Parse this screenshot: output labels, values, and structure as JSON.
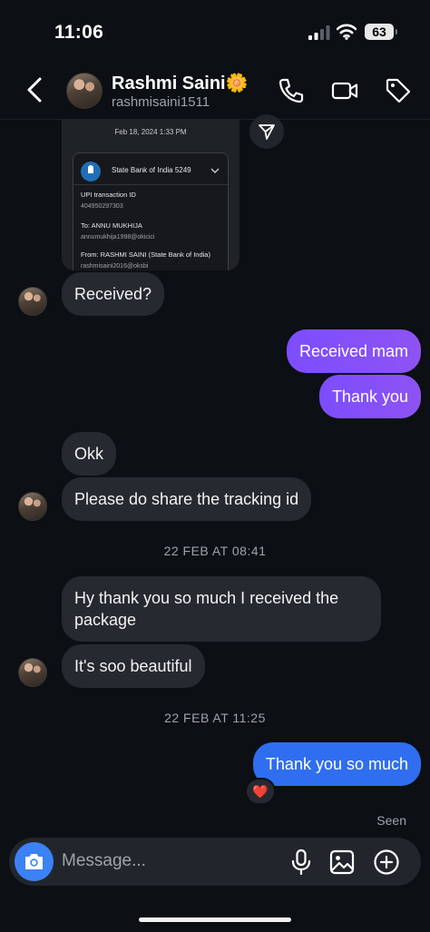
{
  "status_bar": {
    "time": "11:06",
    "battery": "63"
  },
  "header": {
    "name": "Rashmi Saini🌼",
    "username": "rashmisaini1511",
    "icons": [
      "back-arrow-icon",
      "phone-icon",
      "video-call-icon",
      "tag-icon"
    ]
  },
  "shared_card": {
    "date": "Feb 18, 2024 1:33 PM",
    "bank": "State Bank of India 5249",
    "upi_label": "UPI transaction ID",
    "upi_id": "404950297303",
    "to_label": "To: ANNU MUKHIJA",
    "to_handle": "annumukhija1998@okicici",
    "from_label": "From: RASHMI  SAINI (State Bank of India)",
    "from_handle": "rashmisaini2016@oksbi"
  },
  "messages": [
    {
      "side": "in",
      "text": "Received?"
    },
    {
      "side": "out",
      "text": "Received mam"
    },
    {
      "side": "out",
      "text": "Thank you"
    },
    {
      "side": "in",
      "text": "Okk"
    },
    {
      "side": "in",
      "text": "Please do share the tracking id"
    },
    {
      "side": "in",
      "text": "Hy thank you so much I received the package"
    },
    {
      "side": "in",
      "text": "It's soo beautiful"
    },
    {
      "side": "out",
      "text": "Thank you so much",
      "reaction": "❤️"
    }
  ],
  "timestamps": [
    "22 FEB AT 08:41",
    "22 FEB AT 11:25"
  ],
  "seen": "Seen",
  "composer": {
    "placeholder": "Message...",
    "icons": [
      "camera-icon",
      "microphone-icon",
      "gallery-icon",
      "plus-icon"
    ]
  },
  "colors": {
    "background": "#0c0f14",
    "incoming_bubble": "#262a30",
    "outgoing_bubble": "#7c4dff",
    "outgoing_bubble_last": "#2f6ef0",
    "camera_button": "#3b82f6"
  }
}
